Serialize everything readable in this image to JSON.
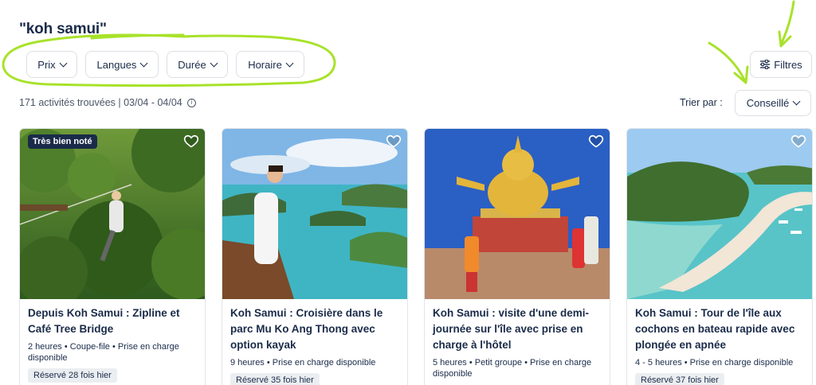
{
  "search": {
    "query": "\"koh samui\""
  },
  "filters": {
    "chips": [
      "Prix",
      "Langues",
      "Durée",
      "Horaire"
    ],
    "all_filters_label": "Filtres"
  },
  "results": {
    "count_text": "171 activités trouvées | 03/04 - 04/04",
    "sort_label": "Trier par :",
    "sort_value": "Conseillé"
  },
  "cards": [
    {
      "badge": "Très bien noté",
      "title": "Depuis Koh Samui : Zipline et Café Tree Bridge",
      "meta": "2 heures • Coupe-file • Prise en charge disponible",
      "booked": "Réservé 28 fois hier"
    },
    {
      "badge": "",
      "title": "Koh Samui : Croisière dans le parc Mu Ko Ang Thong avec option kayak",
      "meta": "9 heures • Prise en charge disponible",
      "booked": "Réservé 35 fois hier"
    },
    {
      "badge": "",
      "title": "Koh Samui : visite d'une demi-journée sur l'île avec prise en charge à l'hôtel",
      "meta": "5 heures • Petit groupe • Prise en charge disponible",
      "booked": ""
    },
    {
      "badge": "",
      "title": "Koh Samui : Tour de l'île aux cochons en bateau rapide avec plongée en apnée",
      "meta": "4 - 5 heures • Prise en charge disponible",
      "booked": "Réservé 37 fois hier"
    }
  ],
  "colors": {
    "text": "#1a2b49",
    "annotation": "#a8e22a",
    "badge_bg": "#1a2b49"
  }
}
